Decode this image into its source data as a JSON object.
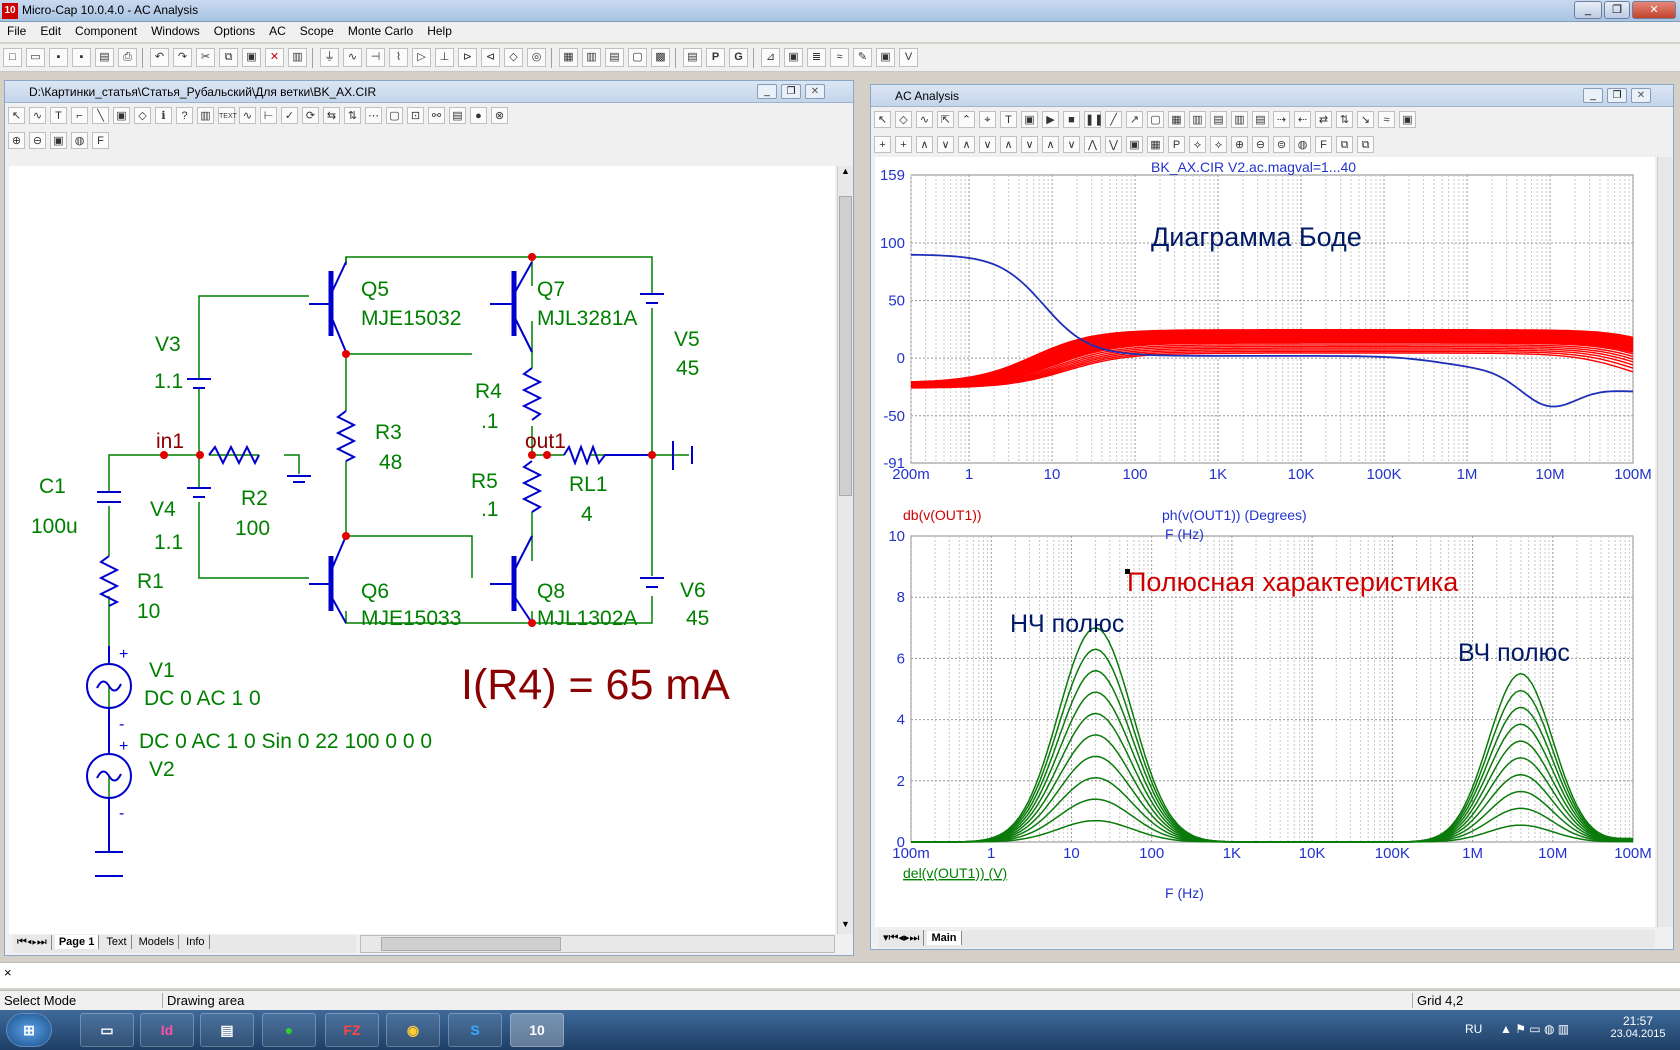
{
  "app": {
    "title": "Micro-Cap 10.0.4.0 - AC Analysis",
    "icon_text": "10"
  },
  "menu": [
    "File",
    "Edit",
    "Component",
    "Windows",
    "Options",
    "AC",
    "Scope",
    "Monte Carlo",
    "Help"
  ],
  "schematic_window": {
    "title": "D:\\Картинки_статья\\Статья_Рубальский\\Для ветки\\BK_AX.CIR",
    "tabs": [
      "Page 1",
      "Text",
      "Models",
      "Info"
    ],
    "components": {
      "Q5": {
        "name": "Q5",
        "model": "MJE15032"
      },
      "Q7": {
        "name": "Q7",
        "model": "MJL3281A"
      },
      "Q6": {
        "name": "Q6",
        "model": "MJE15033"
      },
      "Q8": {
        "name": "Q8",
        "model": "MJL1302A"
      },
      "V3": {
        "name": "V3",
        "value": "1.1"
      },
      "V4": {
        "name": "V4",
        "value": "1.1"
      },
      "V5": {
        "name": "V5",
        "value": "45"
      },
      "V6": {
        "name": "V6",
        "value": "45"
      },
      "R2": {
        "name": "R2",
        "value": "100"
      },
      "R3": {
        "name": "R3",
        "value": "48"
      },
      "R4": {
        "name": "R4",
        "value": ".1"
      },
      "R5": {
        "name": "R5",
        "value": ".1"
      },
      "RL1": {
        "name": "RL1",
        "value": "4"
      },
      "C1": {
        "name": "C1",
        "value": "100u"
      },
      "R1": {
        "name": "R1",
        "value": "10"
      },
      "V1": {
        "name": "V1",
        "value": "DC 0 AC 1 0"
      },
      "V2": {
        "name": "V2",
        "value": "DC 0 AC 1 0 Sin 0 22 100 0 0 0"
      }
    },
    "nodes": {
      "in1": "in1",
      "out1": "out1"
    },
    "annotation": "I(R4) = 65 mA"
  },
  "analysis_window": {
    "title": "AC Analysis",
    "tab": "Main",
    "bode": {
      "header": "BK_AX.CIR V2.ac.magval=1...40",
      "title": "Диаграмма Боде",
      "y_ticks": [
        "159",
        "100",
        "50",
        "0",
        "-50",
        "-91"
      ],
      "x_ticks": [
        "200m",
        "1",
        "10",
        "100",
        "1K",
        "10K",
        "100K",
        "1M",
        "10M",
        "100M"
      ],
      "trace1": "db(v(OUT1))",
      "trace2": "ph(v(OUT1)) (Degrees)",
      "xlabel": "F (Hz)"
    },
    "pole": {
      "title": "Полюсная характеристика",
      "label_lf": "НЧ полюс",
      "label_hf": "ВЧ полюс",
      "y_ticks": [
        "10",
        "8",
        "6",
        "4",
        "2",
        "0"
      ],
      "x_ticks": [
        "100m",
        "1",
        "10",
        "100",
        "1K",
        "10K",
        "100K",
        "1M",
        "10M",
        "100M"
      ],
      "trace": "del(v(OUT1)) (V)",
      "xlabel": "F (Hz)"
    }
  },
  "status": {
    "mode": "Select Mode",
    "area": "Drawing area",
    "grid": "Grid 4,2",
    "close_x": "×"
  },
  "taskbar": {
    "lang": "RU",
    "time": "21:57",
    "date": "23.04.2015",
    "apps": [
      "folder",
      "Id",
      "doc",
      "green",
      "FZ",
      "chrome",
      "S",
      "10"
    ]
  },
  "chart_data": [
    {
      "type": "line",
      "title": "Диаграмма Боде",
      "xlabel": "F (Hz)",
      "x_scale": "log",
      "x_range": [
        0.2,
        100000000
      ],
      "ylim": [
        -91,
        159
      ],
      "series": [
        {
          "name": "ph(v(OUT1)) (Degrees)",
          "x": [
            0.2,
            1,
            5,
            20,
            100,
            1000,
            10000,
            100000,
            1000000,
            10000000,
            100000000
          ],
          "values": [
            88,
            87,
            60,
            10,
            3,
            0.5,
            0,
            -1,
            -10,
            -40,
            -40
          ]
        },
        {
          "name": "db(v(OUT1))",
          "x": [
            0.2,
            1,
            10,
            100,
            1000,
            10000,
            100000,
            1000000,
            100000000
          ],
          "values": [
            -10,
            -3,
            15,
            22,
            22,
            22,
            22,
            21,
            15
          ]
        }
      ]
    },
    {
      "type": "line",
      "title": "Полюсная характеристика",
      "xlabel": "F (Hz)",
      "x_scale": "log",
      "x_range": [
        0.1,
        100000000
      ],
      "ylim": [
        0,
        10
      ],
      "series": [
        {
          "name": "del(v(OUT1)) (V)",
          "x": [
            0.1,
            1,
            20,
            200,
            10000,
            100000,
            4000000,
            30000000,
            100000000
          ],
          "values": [
            0,
            0.3,
            7,
            0.5,
            0,
            0.1,
            5.5,
            0.8,
            1.1
          ]
        }
      ]
    }
  ]
}
